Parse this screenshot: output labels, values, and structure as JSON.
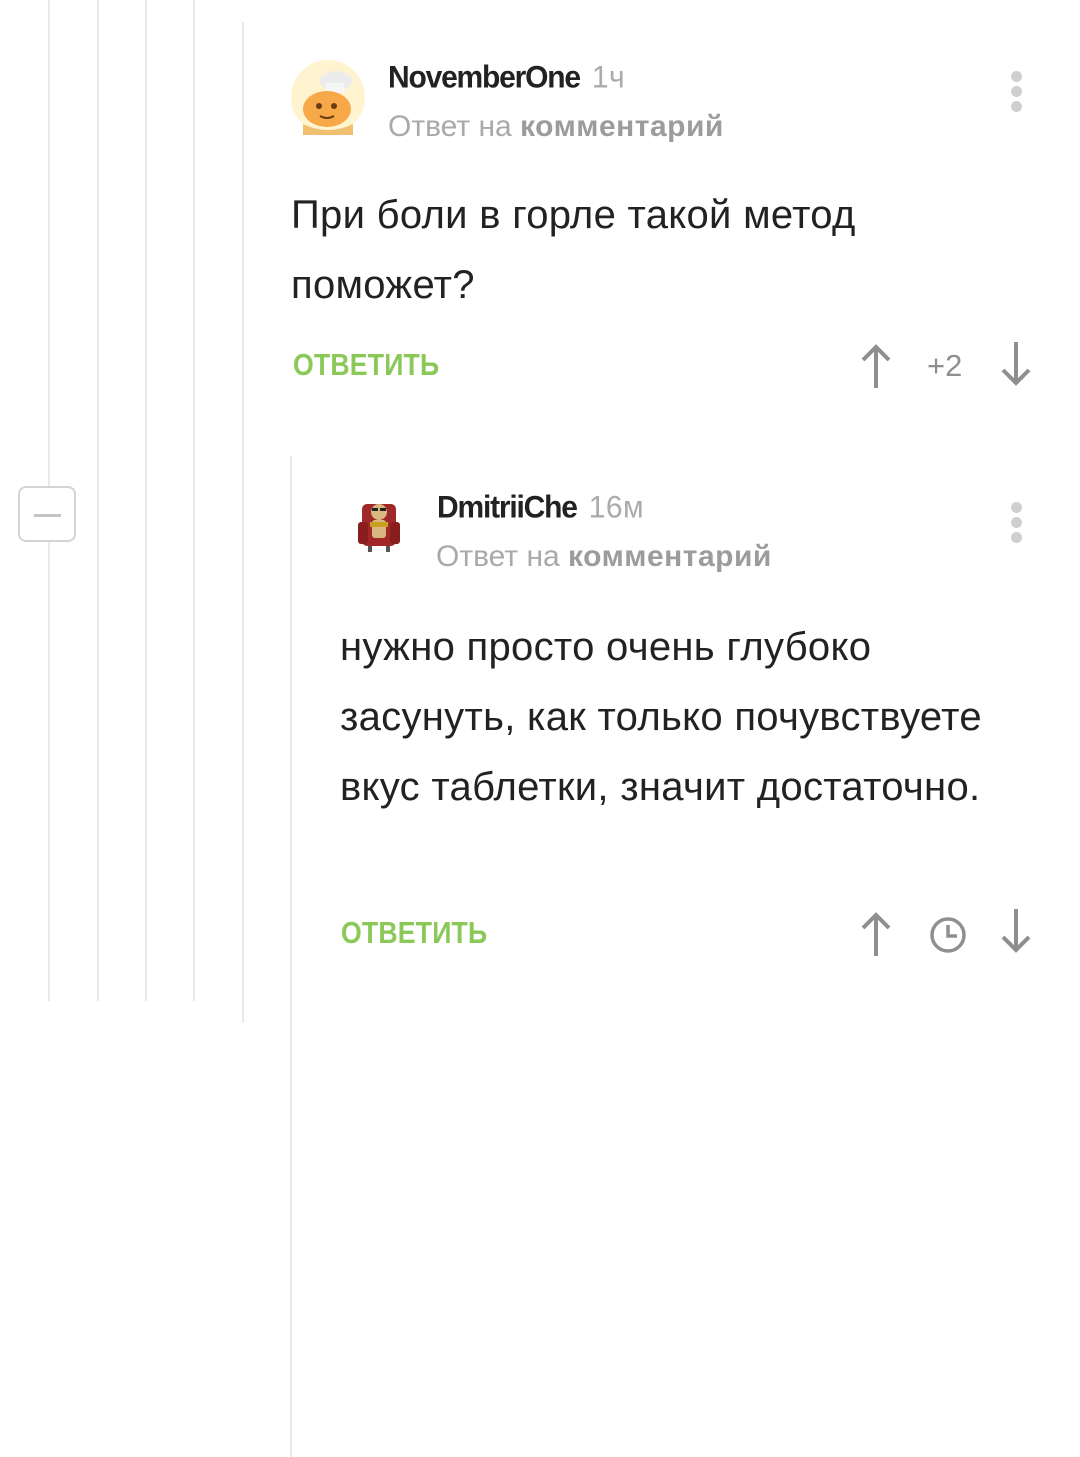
{
  "comments": [
    {
      "author": "NovemberOne",
      "time": "1ч",
      "reply_prefix": "Ответ на",
      "reply_link": "комментарий",
      "text": "При боли в горле такой метод поможет?",
      "reply_label": "ОТВЕТИТЬ",
      "rating": "+2",
      "avatar": "chef-cartoon-avatar"
    },
    {
      "author": "DmitriiChe",
      "time": "16м",
      "reply_prefix": "Ответ на",
      "reply_link": "комментарий",
      "text": "нужно просто очень глубоко засунуть, как только почувствуете вкус таблетки, значит достаточно.",
      "reply_label": "ОТВЕТИТЬ",
      "rating_icon": "clock-icon",
      "avatar": "cartoon-figure-in-armchair-avatar"
    }
  ],
  "icons": [
    "collapse-icon",
    "more-vertical-icon",
    "arrow-up-icon",
    "arrow-down-icon",
    "clock-icon"
  ],
  "colors": {
    "accent_green": "#8ac858",
    "thread_line": "#e9e9e9",
    "muted_text": "#a9a9a9",
    "body_text": "#222222"
  }
}
